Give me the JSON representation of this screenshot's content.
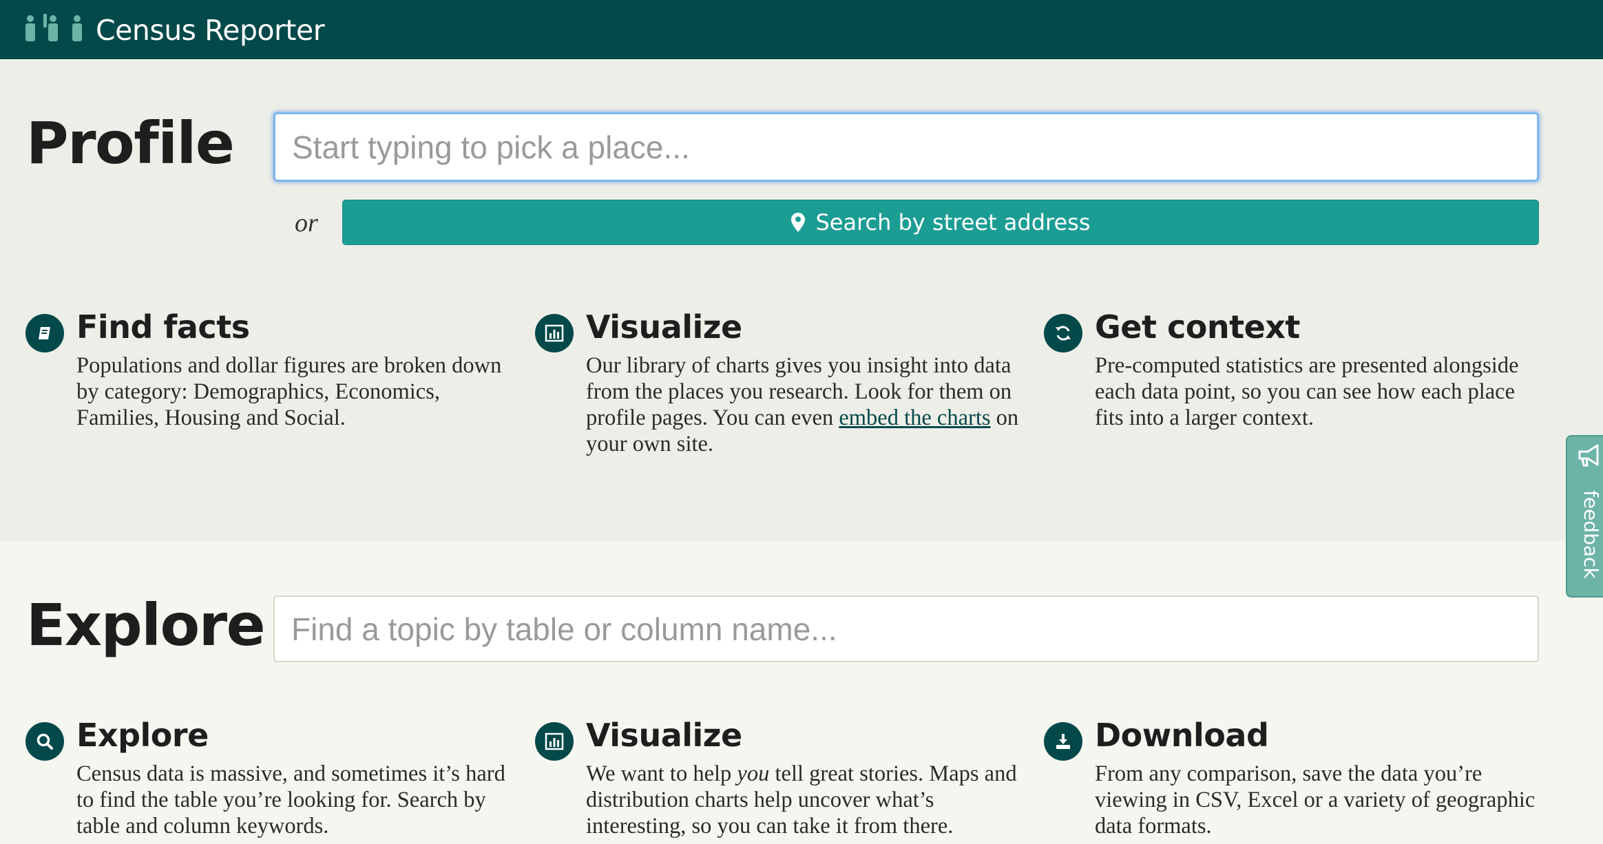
{
  "brand": {
    "name": "Census Reporter",
    "logo_icon": "people-group-icon"
  },
  "colors": {
    "header_bg": "#04494a",
    "accent_teal": "#1c9d94",
    "profile_bg": "#eeeee8",
    "explore_bg": "#f6f6f1",
    "feedback_tab": "#6db3a7"
  },
  "profile": {
    "title": "Profile",
    "search_placeholder": "Start typing to pick a place...",
    "or_label": "or",
    "address_button": {
      "icon": "map-marker-icon",
      "label": "Search by street address"
    },
    "features": [
      {
        "icon": "book-icon",
        "title": "Find facts",
        "description": "Populations and dollar figures are broken down by category: Demographics, Economics, Families, Housing and Social."
      },
      {
        "icon": "bar-chart-icon",
        "title": "Visualize",
        "description_before": "Our library of charts gives you insight into data from the places you research. Look for them on profile pages. You can even ",
        "link": "embed the charts",
        "description_after": " on your own site."
      },
      {
        "icon": "refresh-icon",
        "title": "Get context",
        "description": "Pre-computed statistics are presented alongside each data point, so you can see how each place fits into a larger context."
      }
    ]
  },
  "explore": {
    "title": "Explore",
    "search_placeholder": "Find a topic by table or column name...",
    "features": [
      {
        "icon": "search-icon",
        "title": "Explore",
        "description": "Census data is massive, and sometimes it’s hard to find the table you’re looking for. Search by table and column keywords."
      },
      {
        "icon": "bar-chart-icon",
        "title": "Visualize",
        "description_before": "We want to help ",
        "emphasis": "you",
        "description_after": " tell great stories. Maps and distribution charts help uncover what’s interesting, so you can take it from there."
      },
      {
        "icon": "download-icon",
        "title": "Download",
        "description": "From any comparison, save the data you’re viewing in CSV, Excel or a variety of geographic data formats."
      }
    ]
  },
  "feedback": {
    "label": "feedback",
    "icon": "megaphone-icon"
  }
}
